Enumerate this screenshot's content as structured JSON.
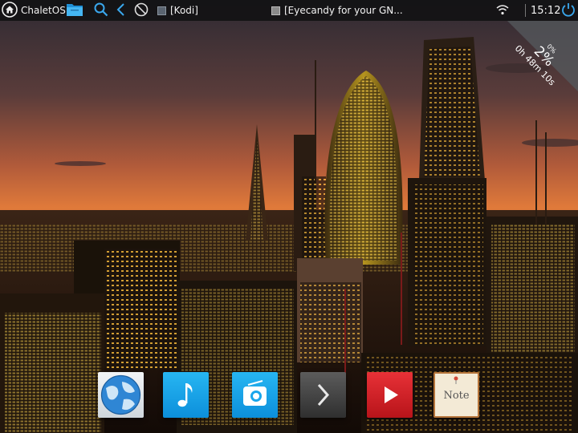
{
  "panel": {
    "menu_label": "ChaletOS",
    "tasks": [
      {
        "label": "[Kodi]"
      },
      {
        "label": "[Eyecandy for your GN..."
      }
    ],
    "clock": "15:12"
  },
  "battery": {
    "small_percent": "0%",
    "percent": "2%",
    "time_remaining": "0h 48m 10s"
  },
  "dock": {
    "items": [
      "browser-icon",
      "music-icon",
      "radio-icon",
      "terminal-icon",
      "video-icon",
      "note-icon"
    ],
    "note_label": "Note"
  },
  "colors": {
    "panel_bg": "#121214",
    "accent_blue": "#1aa6ec",
    "video_red": "#d62228"
  }
}
